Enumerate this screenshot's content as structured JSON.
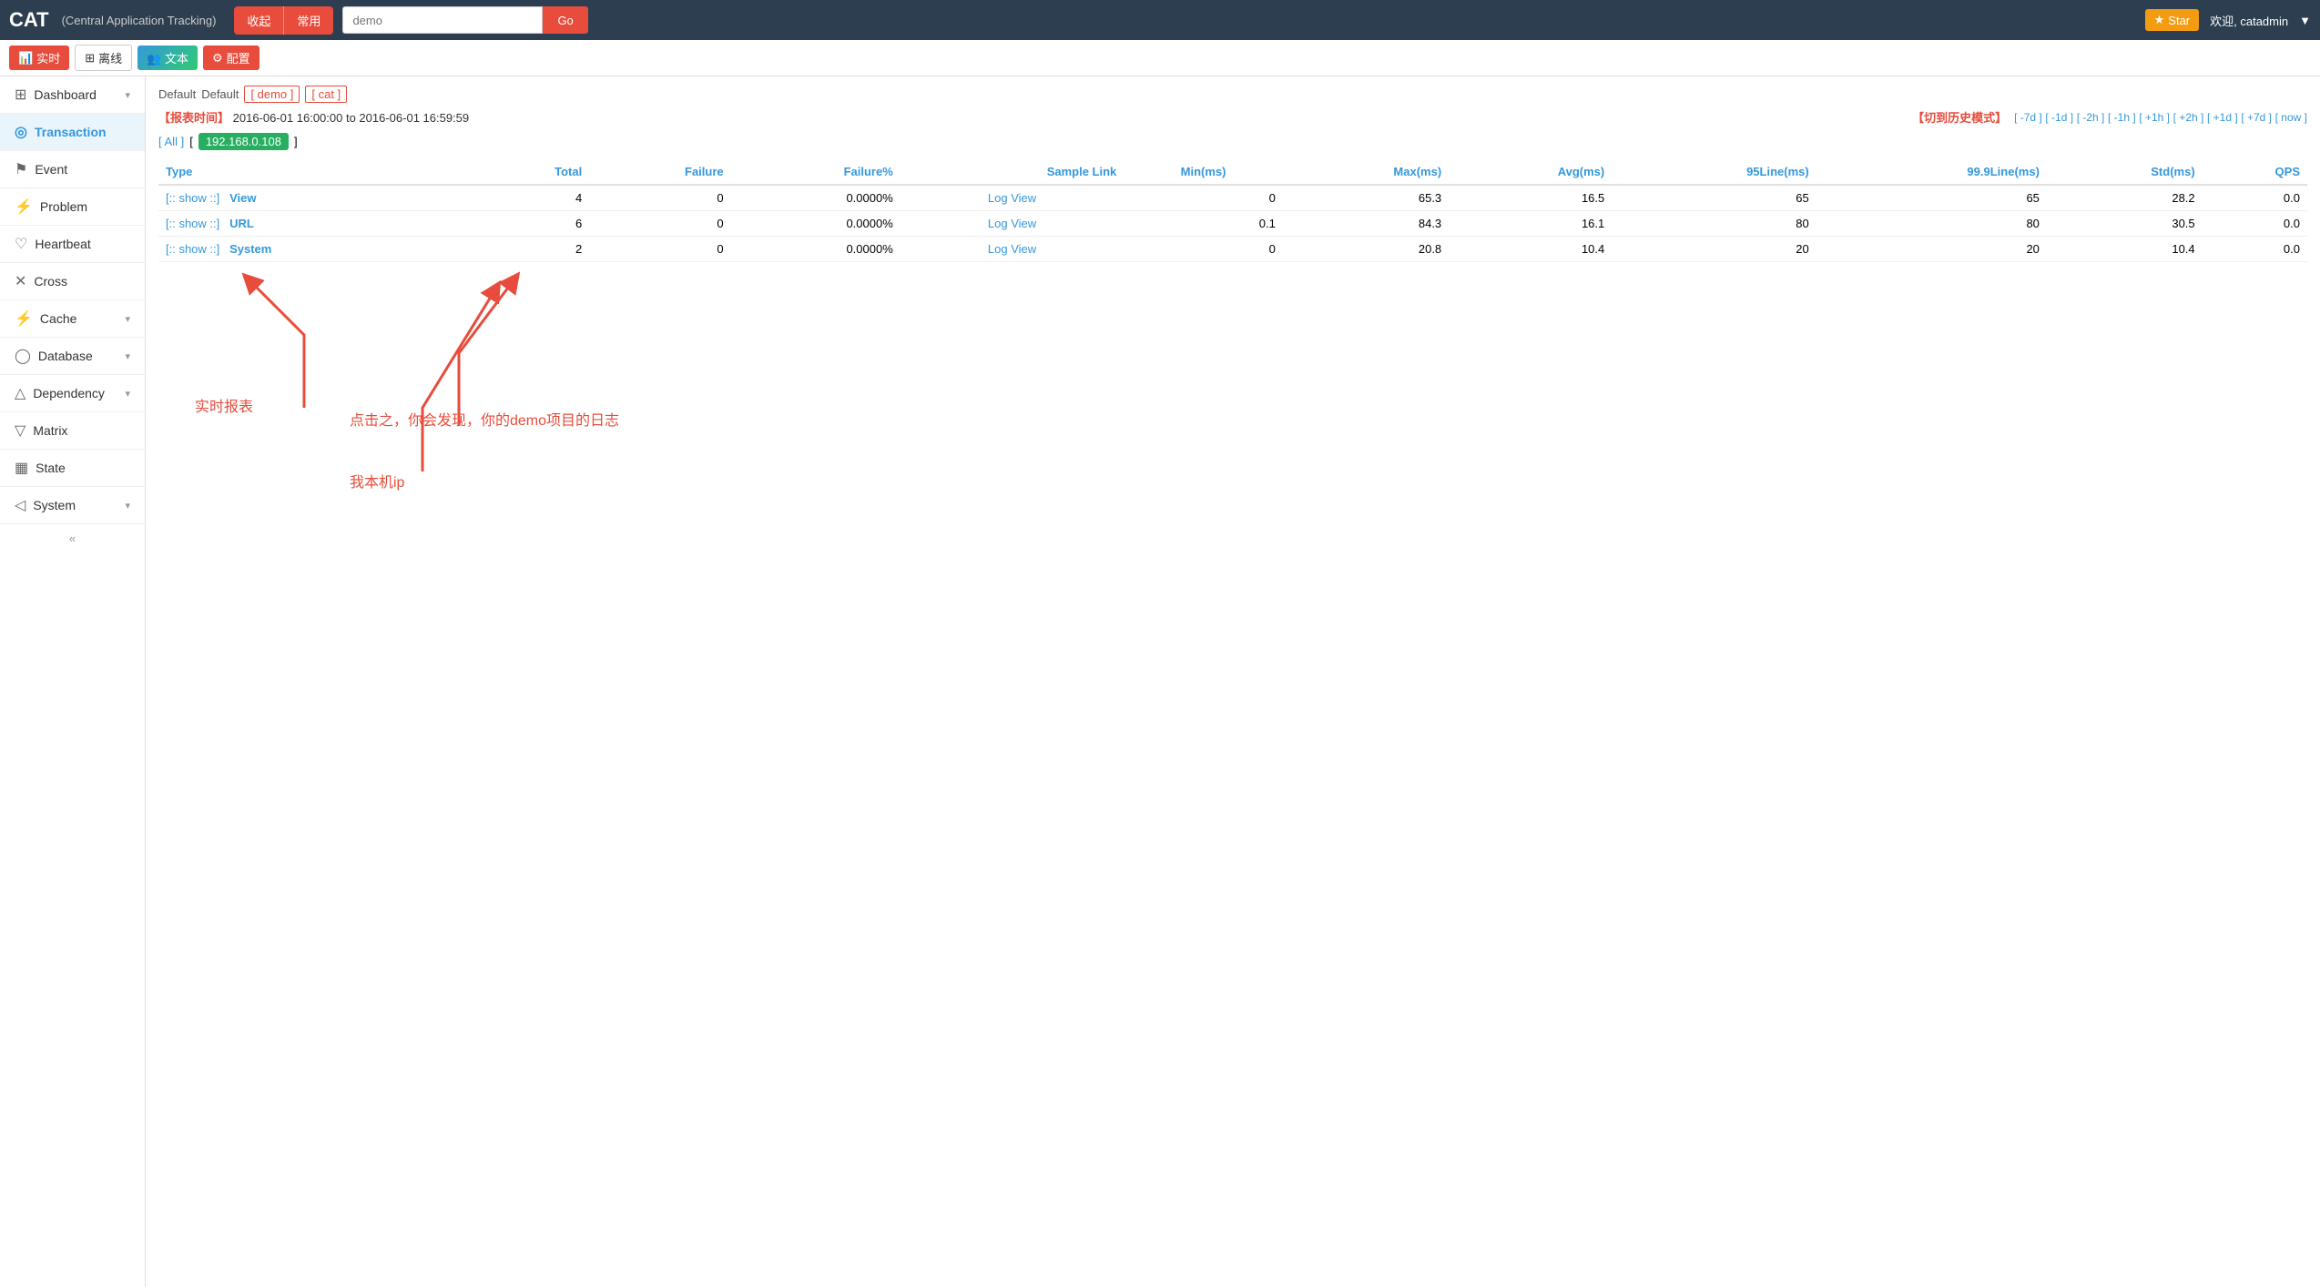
{
  "app": {
    "logo": "CAT",
    "subtitle": "(Central Application Tracking)"
  },
  "topnav": {
    "btn_collapse": "收起",
    "btn_common": "常用",
    "search_placeholder": "demo",
    "btn_go": "Go",
    "star_label": "Star",
    "welcome": "欢迎, catadmin"
  },
  "secondrow": {
    "btn_realtime": "实时",
    "btn_likai": "离线",
    "btn_wenzi": "文本",
    "btn_peizhi": "配置"
  },
  "breadcrumb": {
    "default1": "Default",
    "default2": "Default",
    "link_demo": "[ demo ]",
    "link_cat": "[ cat ]"
  },
  "time": {
    "label": "【报表时间】",
    "value": "2016-06-01 16:00:00 to 2016-06-01 16:59:59",
    "hist_label": "【切到历史模式】",
    "nav_items": [
      "[ -7d ]",
      "[ -1d ]",
      "[ -2h ]",
      "[ -1h ]",
      "[ +1h ]",
      "[ +2h ]",
      "[ +1d ]",
      "[ +7d ]",
      "[ now ]"
    ]
  },
  "ip_filter": {
    "all": "[ All ]",
    "bracket_open": "[",
    "ip": "192.168.0.108",
    "bracket_close": "]"
  },
  "table": {
    "columns": [
      "Type",
      "Total",
      "Failure",
      "Failure%",
      "Sample Link",
      "Min(ms)",
      "Max(ms)",
      "Avg(ms)",
      "95Line(ms)",
      "99.9Line(ms)",
      "Std(ms)",
      "QPS"
    ],
    "rows": [
      {
        "show": "[:: show ::]",
        "type": "View",
        "total": 4,
        "failure": 0,
        "failure_pct": "0.0000%",
        "sample_link": "Log View",
        "min": 0,
        "max": 65.3,
        "avg": 16.5,
        "line95": 65.0,
        "line999": 65.0,
        "std": 28.2,
        "qps": 0.0
      },
      {
        "show": "[:: show ::]",
        "type": "URL",
        "total": 6,
        "failure": 0,
        "failure_pct": "0.0000%",
        "sample_link": "Log View",
        "min": 0.1,
        "max": 84.3,
        "avg": 16.1,
        "line95": 80.0,
        "line999": 80.0,
        "std": 30.5,
        "qps": 0.0
      },
      {
        "show": "[:: show ::]",
        "type": "System",
        "total": 2,
        "failure": 0,
        "failure_pct": "0.0000%",
        "sample_link": "Log View",
        "min": 0,
        "max": 20.8,
        "avg": 10.4,
        "line95": 20.0,
        "line999": 20.0,
        "std": 10.4,
        "qps": 0.0
      }
    ]
  },
  "annotations": {
    "realtime_report": "实时报表",
    "click_demo": "点击之，你会发现，你的demo项目的日志",
    "local_ip": "我本机ip"
  },
  "sidebar": {
    "items": [
      {
        "label": "Dashboard",
        "icon": "⊞",
        "has_children": true
      },
      {
        "label": "Transaction",
        "icon": "◎",
        "has_children": false,
        "active": true
      },
      {
        "label": "Event",
        "icon": "⚑",
        "has_children": false
      },
      {
        "label": "Problem",
        "icon": "⚡",
        "has_children": false
      },
      {
        "label": "Heartbeat",
        "icon": "♡",
        "has_children": false
      },
      {
        "label": "Cross",
        "icon": "✕",
        "has_children": false
      },
      {
        "label": "Cache",
        "icon": "⚡",
        "has_children": true
      },
      {
        "label": "Database",
        "icon": "◯",
        "has_children": true
      },
      {
        "label": "Dependency",
        "icon": "△",
        "has_children": true
      },
      {
        "label": "Matrix",
        "icon": "▽",
        "has_children": false
      },
      {
        "label": "State",
        "icon": "▦",
        "has_children": false
      },
      {
        "label": "System",
        "icon": "◁",
        "has_children": true
      }
    ]
  }
}
